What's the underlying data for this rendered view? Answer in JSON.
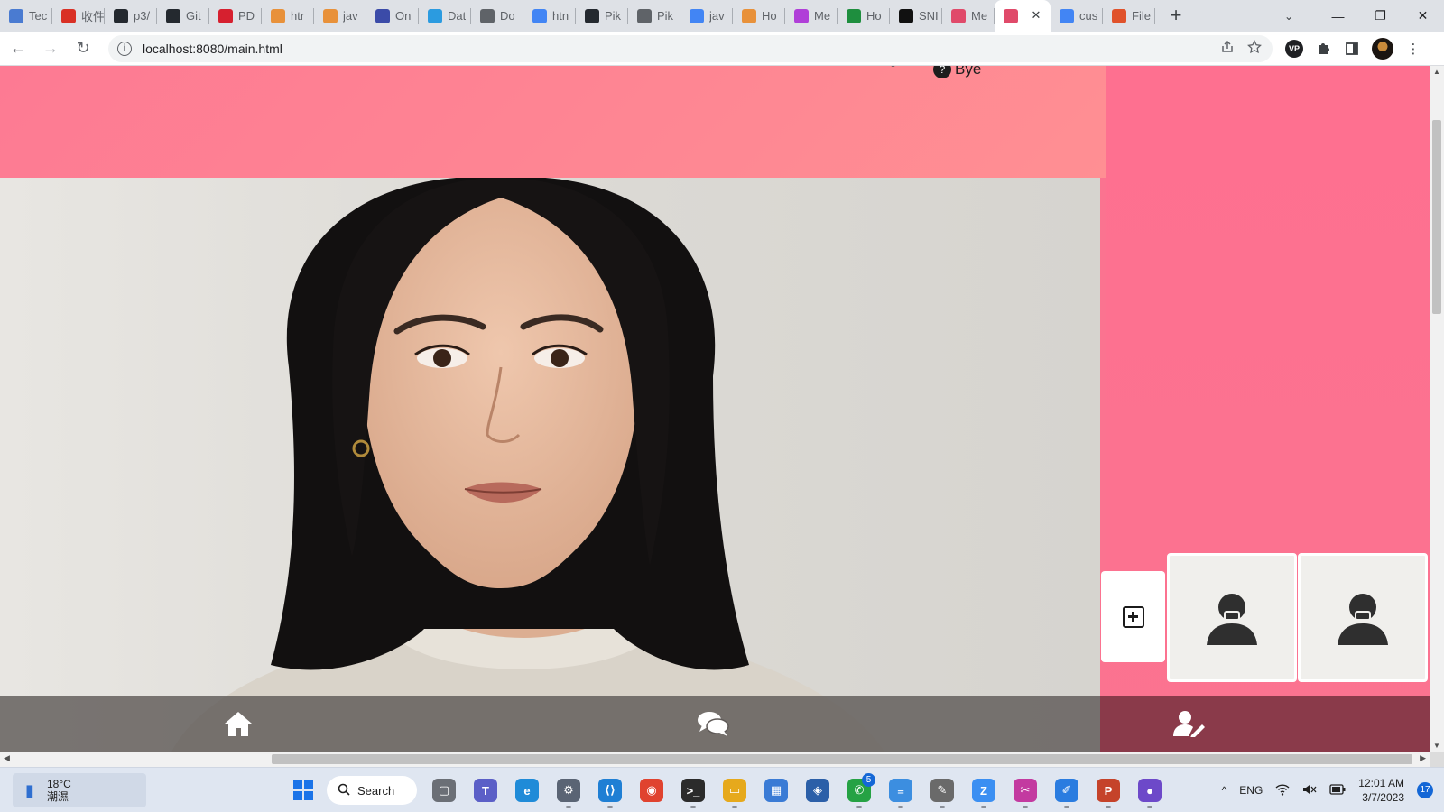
{
  "browser": {
    "tabs": [
      {
        "title": "Tec",
        "icon": "docs-copy-icon",
        "color": "#4a7bd1"
      },
      {
        "title": "收件",
        "icon": "gmail-icon",
        "color": "#d93025"
      },
      {
        "title": "p3/",
        "icon": "github-icon",
        "color": "#24292f"
      },
      {
        "title": "Git",
        "icon": "github-icon",
        "color": "#24292f"
      },
      {
        "title": "PD",
        "icon": "heart-icon",
        "color": "#d6202f"
      },
      {
        "title": "htr",
        "icon": "stackoverflow-icon",
        "color": "#e8913a"
      },
      {
        "title": "jav",
        "icon": "stackoverflow-icon",
        "color": "#e8913a"
      },
      {
        "title": "On",
        "icon": "notebook-icon",
        "color": "#3b4ba8"
      },
      {
        "title": "Dat",
        "icon": "database-icon",
        "color": "#2b9be0"
      },
      {
        "title": "Do",
        "icon": "globe-icon",
        "color": "#5f6368"
      },
      {
        "title": "htn",
        "icon": "google-icon",
        "color": "#4285f4"
      },
      {
        "title": "Pik",
        "icon": "github-icon",
        "color": "#24292f"
      },
      {
        "title": "Pik",
        "icon": "globe-icon",
        "color": "#5f6368"
      },
      {
        "title": "jav",
        "icon": "google-icon",
        "color": "#4285f4"
      },
      {
        "title": "Ho",
        "icon": "stackoverflow-icon",
        "color": "#e8913a"
      },
      {
        "title": "Me",
        "icon": "medium-icon",
        "color": "#b03fd8"
      },
      {
        "title": "Ho",
        "icon": "w-icon",
        "color": "#1e8e3e"
      },
      {
        "title": "SNI",
        "icon": "sn-icon",
        "color": "#111111"
      },
      {
        "title": "Me",
        "icon": "app-icon",
        "color": "#e04a6a"
      }
    ],
    "active_tab": {
      "icon": "app-icon",
      "color": "#e04a6a",
      "close": "✕"
    },
    "tabs_after": [
      {
        "title": "cus",
        "icon": "google-icon",
        "color": "#4285f4"
      },
      {
        "title": "File",
        "icon": "code-icon",
        "color": "#e0522b"
      }
    ],
    "new_tab": "+",
    "window_controls": {
      "tab_search": "⌄",
      "minimize": "—",
      "restore": "❐",
      "close": "✕"
    },
    "nav": {
      "back": "←",
      "forward": "→",
      "reload": "↻"
    },
    "url": "localhost:8080/main.html",
    "site_info": "i"
  },
  "page": {
    "header_link": "Bye",
    "header_link_icon": "?",
    "add_profile_label": "add-profile",
    "profiles": [
      "profile-1",
      "profile-2"
    ],
    "colors": {
      "pink": "#fe7090",
      "nav_dark": "#8a3a4a"
    },
    "nav": [
      {
        "name": "home",
        "icon": "home-icon"
      },
      {
        "name": "chat",
        "icon": "chat-icon"
      },
      {
        "name": "profile",
        "icon": "user-edit-icon"
      }
    ],
    "scroll": {
      "up": "▲",
      "down": "▼",
      "left": "◀",
      "right": "▶"
    }
  },
  "taskbar": {
    "weather_temp": "18°C",
    "weather_desc": "潮濕",
    "search_label": "Search",
    "apps": [
      {
        "name": "task-view",
        "glyph": "▢",
        "bg": "#6b6f76",
        "state": ""
      },
      {
        "name": "teams",
        "glyph": "T",
        "bg": "#5b5fc7",
        "state": ""
      },
      {
        "name": "edge",
        "glyph": "e",
        "bg": "#1f8bd8",
        "state": ""
      },
      {
        "name": "settings",
        "glyph": "⚙",
        "bg": "#5a6474",
        "state": "running"
      },
      {
        "name": "vscode",
        "glyph": "⟨⟩",
        "bg": "#1f7fd4",
        "state": "running"
      },
      {
        "name": "chrome",
        "glyph": "◉",
        "bg": "#e0432f",
        "state": "focus"
      },
      {
        "name": "terminal",
        "glyph": ">_",
        "bg": "#2b2b2b",
        "state": "running"
      },
      {
        "name": "explorer",
        "glyph": "▭",
        "bg": "#e6a91c",
        "state": "running"
      },
      {
        "name": "store",
        "glyph": "▦",
        "bg": "#3a7bd5",
        "state": ""
      },
      {
        "name": "app-blue",
        "glyph": "◈",
        "bg": "#2b5fa8",
        "state": ""
      },
      {
        "name": "whatsapp",
        "glyph": "✆",
        "bg": "#25a244",
        "state": "running",
        "badge": "5"
      },
      {
        "name": "notepad",
        "glyph": "≡",
        "bg": "#3c8ee0",
        "state": "running"
      },
      {
        "name": "paint",
        "glyph": "✎",
        "bg": "#6a6a6a",
        "state": "running"
      },
      {
        "name": "zoom",
        "glyph": "Z",
        "bg": "#3b8ff2",
        "state": "running"
      },
      {
        "name": "snipping",
        "glyph": "✂",
        "bg": "#c33aa0",
        "state": "running"
      },
      {
        "name": "whiteboard",
        "glyph": "✐",
        "bg": "#2a7ce0",
        "state": "running"
      },
      {
        "name": "powerpoint",
        "glyph": "P",
        "bg": "#c5432a",
        "state": "running"
      },
      {
        "name": "app-purple",
        "glyph": "●",
        "bg": "#6d49c9",
        "state": "running"
      }
    ],
    "tray": {
      "chevron": "^",
      "language": "ENG",
      "wifi": "wifi",
      "volume": "muted",
      "battery": "battery"
    },
    "time": "12:01 AM",
    "date": "3/7/2023",
    "notifications": "17"
  }
}
